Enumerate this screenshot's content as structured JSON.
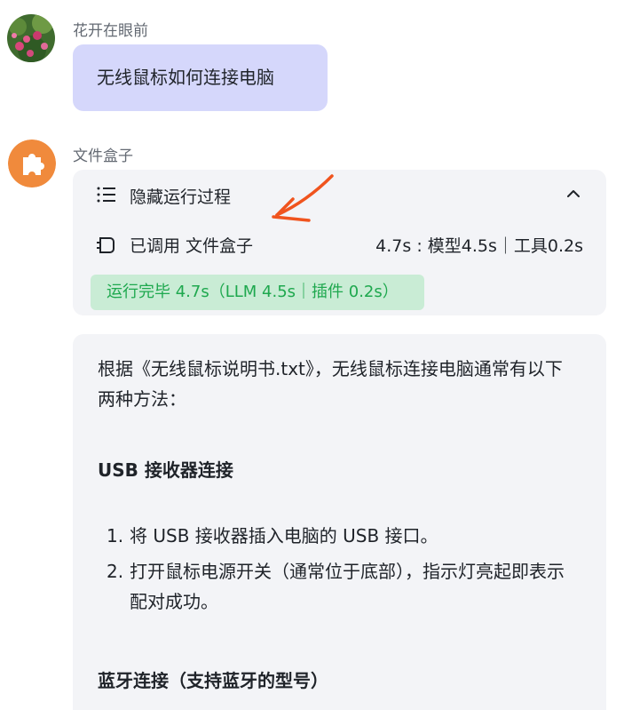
{
  "user_message": {
    "sender": "花开在眼前",
    "text": "无线鼠标如何连接电脑",
    "avatar_icon": "flower-photo-avatar"
  },
  "bot_message": {
    "sender": "文件盒子",
    "avatar_icon": "puzzle-piece-icon",
    "avatar_color": "#f08a3c",
    "process": {
      "toggle_label": "隐藏运行过程",
      "tool_called_label": "已调用 文件盒子",
      "tool_timing": "4.7s : 模型4.5s｜工具0.2s",
      "status_label": "运行完毕 4.7s（LLM 4.5s｜插件 0.2s）",
      "status_color": "#1ea84e"
    },
    "answer": {
      "intro": "根据《无线鼠标说明书.txt》，无线鼠标连接电脑通常有以下两种方法：",
      "sections": [
        {
          "heading": "USB 接收器连接",
          "steps": [
            {
              "num": "1.",
              "text": "将 USB 接收器插入电脑的 USB 接口。"
            },
            {
              "num": "2.",
              "text": "打开鼠标电源开关（通常位于底部），指示灯亮起即表示配对成功。"
            }
          ]
        },
        {
          "heading": "蓝牙连接（支持蓝牙的型号）",
          "steps": []
        }
      ]
    }
  },
  "annotation": {
    "arrow_color": "#f0541e"
  }
}
